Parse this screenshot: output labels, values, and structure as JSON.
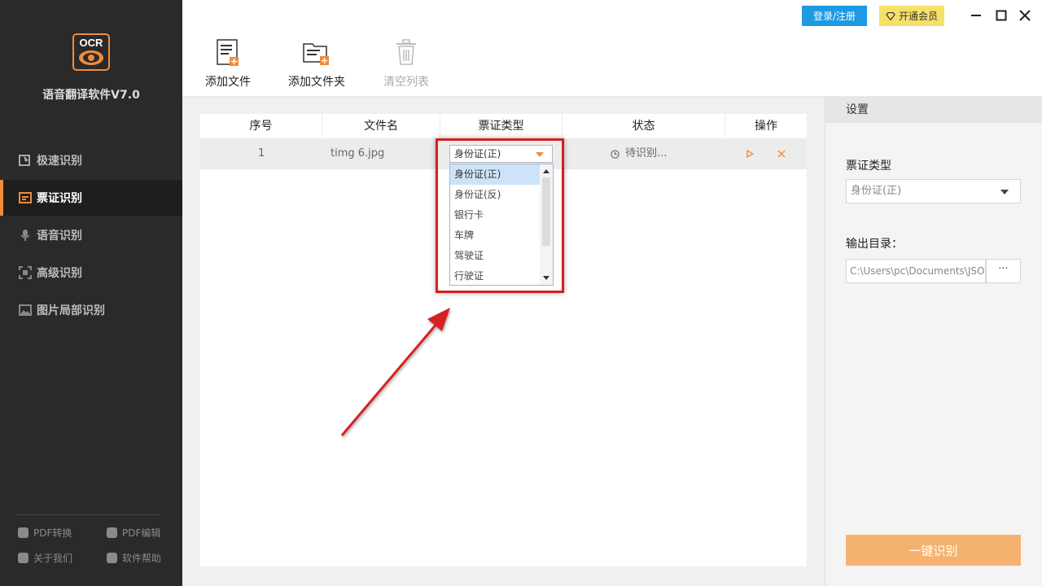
{
  "app": {
    "logo_text": "OCR",
    "name": "语音翻译软件V7.0"
  },
  "sidebar": {
    "items": [
      {
        "label": "极速识别",
        "icon": "speed-icon",
        "active": false
      },
      {
        "label": "票证识别",
        "icon": "ticket-icon",
        "active": true
      },
      {
        "label": "语音识别",
        "icon": "microphone-icon",
        "active": false
      },
      {
        "label": "高级识别",
        "icon": "scan-icon",
        "active": false
      },
      {
        "label": "图片局部识别",
        "icon": "image-icon",
        "active": false
      }
    ],
    "footer": [
      {
        "label": "PDF转换",
        "icon": "pdf-convert-icon"
      },
      {
        "label": "PDF编辑",
        "icon": "pdf-edit-icon"
      },
      {
        "label": "关于我们",
        "icon": "about-icon"
      },
      {
        "label": "软件帮助",
        "icon": "help-icon"
      }
    ]
  },
  "titlebar": {
    "login_label": "登录/注册",
    "vip_label": "开通会员"
  },
  "toolbar": {
    "add_file": "添加文件",
    "add_folder": "添加文件夹",
    "clear_list": "清空列表"
  },
  "table": {
    "headers": [
      "序号",
      "文件名",
      "票证类型",
      "状态",
      "操作"
    ],
    "rows": [
      {
        "index": "1",
        "filename": "timg 6.jpg",
        "type": "身份证(正)",
        "status": "待识别..."
      }
    ]
  },
  "dropdown": {
    "options": [
      "身份证(正)",
      "身份证(反)",
      "银行卡",
      "车牌",
      "驾驶证",
      "行驶证"
    ],
    "selected": "身份证(正)"
  },
  "settings": {
    "title": "设置",
    "ticket_type_label": "票证类型",
    "ticket_type_value": "身份证(正)",
    "output_dir_label": "输出目录：",
    "output_dir_value": "C:\\Users\\pc\\Documents\\JSO",
    "browse_label": "···",
    "run_label": "一键识别"
  },
  "colors": {
    "sidebar_bg": "#2a2a2a",
    "accent": "#f08c3a",
    "login_blue": "#1e9ae0",
    "vip_yellow": "#f7e06a",
    "highlight_red": "#d42020",
    "run_button": "#f5b26e"
  }
}
